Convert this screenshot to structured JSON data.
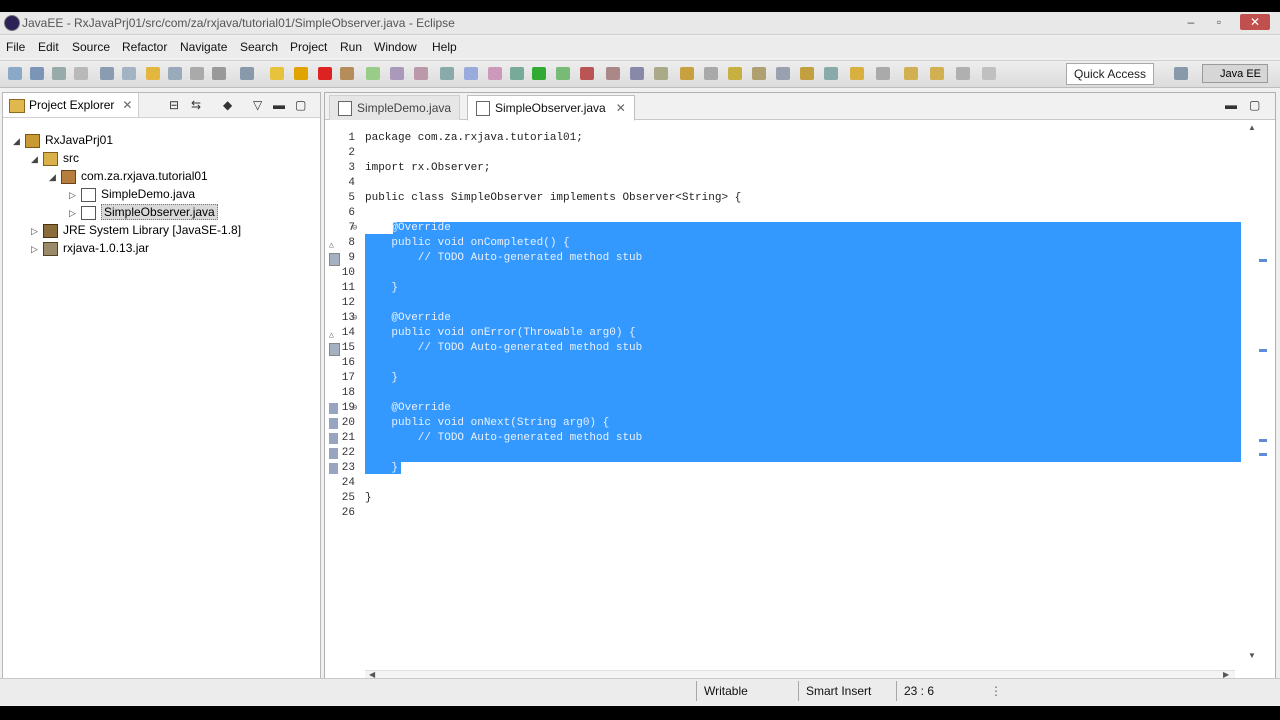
{
  "window": {
    "title": "JavaEE - RxJavaPrj01/src/com/za/rxjava/tutorial01/SimpleObserver.java - Eclipse",
    "minimize": "–",
    "maximize": "▫",
    "close": "✕"
  },
  "menu": [
    "File",
    "Edit",
    "Source",
    "Refactor",
    "Navigate",
    "Search",
    "Project",
    "Run",
    "Window",
    "Help"
  ],
  "toolbar": {
    "quick_access": "Quick Access",
    "perspective": "Java EE"
  },
  "project_explorer": {
    "tab_label": "Project Explorer",
    "tree": [
      {
        "label": "RxJavaPrj01",
        "depth": 0,
        "expanded": true,
        "icon": "project-icon"
      },
      {
        "label": "src",
        "depth": 1,
        "expanded": true,
        "icon": "source-folder-icon"
      },
      {
        "label": "com.za.rxjava.tutorial01",
        "depth": 2,
        "expanded": true,
        "icon": "package-icon"
      },
      {
        "label": "SimpleDemo.java",
        "depth": 3,
        "expanded": false,
        "icon": "java-file-icon"
      },
      {
        "label": "SimpleObserver.java",
        "depth": 3,
        "expanded": false,
        "icon": "java-file-icon",
        "selected": true
      },
      {
        "label": "JRE System Library [JavaSE-1.8]",
        "depth": 1,
        "expanded": false,
        "icon": "library-icon"
      },
      {
        "label": "rxjava-1.0.13.jar",
        "depth": 1,
        "expanded": false,
        "icon": "jar-icon"
      }
    ]
  },
  "editor": {
    "tabs": [
      {
        "label": "SimpleDemo.java",
        "active": false
      },
      {
        "label": "SimpleObserver.java",
        "active": true
      }
    ],
    "lines": [
      {
        "n": "1",
        "text": "package com.za.rxjava.tutorial01;"
      },
      {
        "n": "2",
        "text": ""
      },
      {
        "n": "3",
        "text": "import rx.Observer;"
      },
      {
        "n": "4",
        "text": ""
      },
      {
        "n": "5",
        "text": "public class SimpleObserver implements Observer<String> {"
      },
      {
        "n": "6",
        "text": ""
      },
      {
        "n": "7",
        "text": "    @Override",
        "fold": "⊖",
        "selected": true
      },
      {
        "n": "8",
        "text": "    public void onCompleted() {",
        "fold": "",
        "selected": true,
        "marker": "override"
      },
      {
        "n": "9",
        "text": "        // TODO Auto-generated method stub",
        "selected": true,
        "marker": "task"
      },
      {
        "n": "10",
        "text": "",
        "selected": true
      },
      {
        "n": "11",
        "text": "    }",
        "selected": true
      },
      {
        "n": "12",
        "text": "",
        "selected": true
      },
      {
        "n": "13",
        "text": "    @Override",
        "fold": "⊖",
        "selected": true
      },
      {
        "n": "14",
        "text": "    public void onError(Throwable arg0) {",
        "selected": true,
        "marker": "override"
      },
      {
        "n": "15",
        "text": "        // TODO Auto-generated method stub",
        "selected": true,
        "marker": "task"
      },
      {
        "n": "16",
        "text": "",
        "selected": true
      },
      {
        "n": "17",
        "text": "    }",
        "selected": true
      },
      {
        "n": "18",
        "text": "",
        "selected": true
      },
      {
        "n": "19",
        "text": "    @Override",
        "fold": "⊖",
        "selected": true,
        "marker": "change"
      },
      {
        "n": "20",
        "text": "    public void onNext(String arg0) {",
        "selected": true,
        "marker": "change"
      },
      {
        "n": "21",
        "text": "        // TODO Auto-generated method stub",
        "selected": true,
        "marker": "change"
      },
      {
        "n": "22",
        "text": "",
        "selected": true,
        "marker": "change"
      },
      {
        "n": "23",
        "text": "    }",
        "selected": true,
        "marker": "change"
      },
      {
        "n": "24",
        "text": ""
      },
      {
        "n": "25",
        "text": "}"
      },
      {
        "n": "26",
        "text": ""
      }
    ]
  },
  "status": {
    "writable": "Writable",
    "insert_mode": "Smart Insert",
    "position": "23 : 6"
  }
}
